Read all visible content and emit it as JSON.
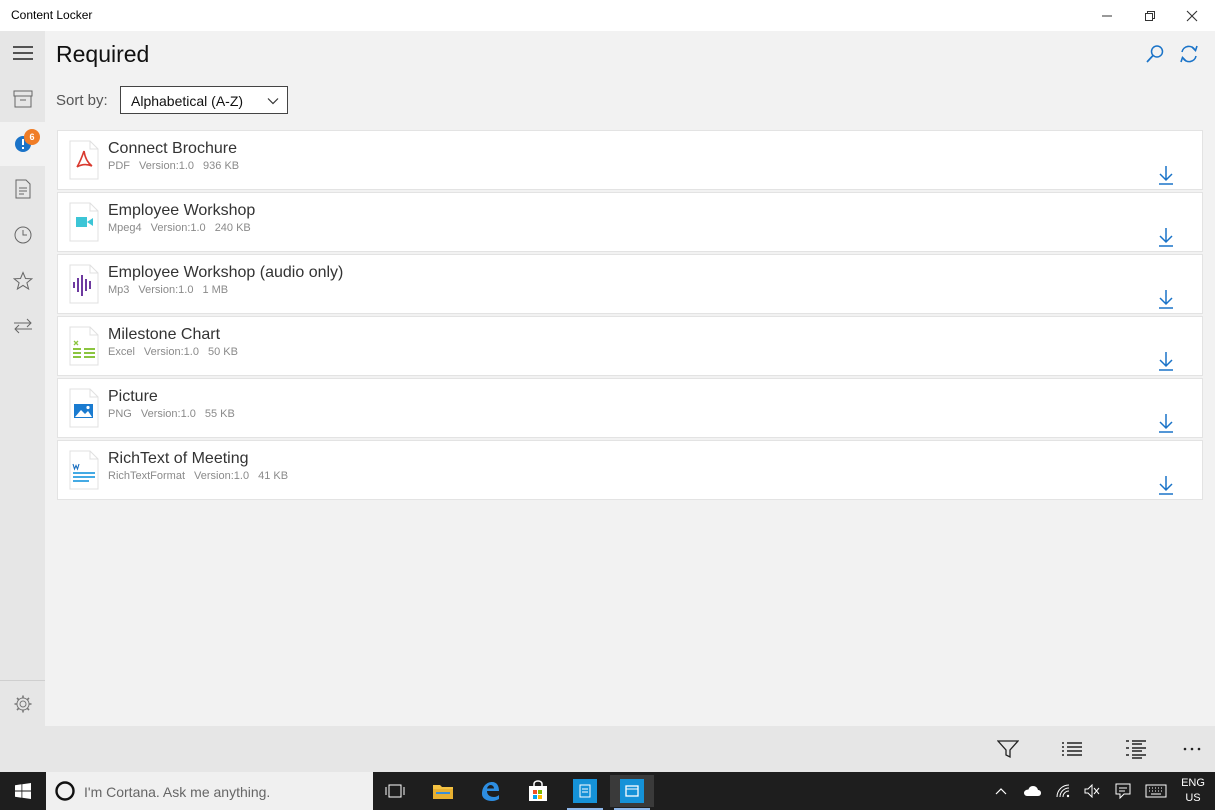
{
  "window": {
    "title": "Content Locker"
  },
  "rail": {
    "badge_count": "6",
    "accent": "#1a73c8",
    "badge_color": "#f07d27"
  },
  "page": {
    "title": "Required"
  },
  "sort": {
    "label": "Sort by:",
    "value": "Alphabetical (A-Z)"
  },
  "files": [
    {
      "name": "Connect Brochure",
      "type": "PDF",
      "version": "Version:1.0",
      "size": "936 KB",
      "icon": "pdf-icon"
    },
    {
      "name": "Employee Workshop",
      "type": "Mpeg4",
      "version": "Version:1.0",
      "size": "240 KB",
      "icon": "video-icon"
    },
    {
      "name": "Employee Workshop (audio only)",
      "type": "Mp3",
      "version": "Version:1.0",
      "size": "1 MB",
      "icon": "audio-icon"
    },
    {
      "name": "Milestone Chart",
      "type": "Excel",
      "version": "Version:1.0",
      "size": "50 KB",
      "icon": "excel-icon"
    },
    {
      "name": "Picture",
      "type": "PNG",
      "version": "Version:1.0",
      "size": "55 KB",
      "icon": "image-icon"
    },
    {
      "name": "RichText of Meeting",
      "type": "RichTextFormat",
      "version": "Version:1.0",
      "size": "41 KB",
      "icon": "word-icon"
    }
  ],
  "taskbar": {
    "cortana_placeholder": "I'm Cortana. Ask me anything.",
    "lang_line1": "ENG",
    "lang_line2": "US"
  }
}
